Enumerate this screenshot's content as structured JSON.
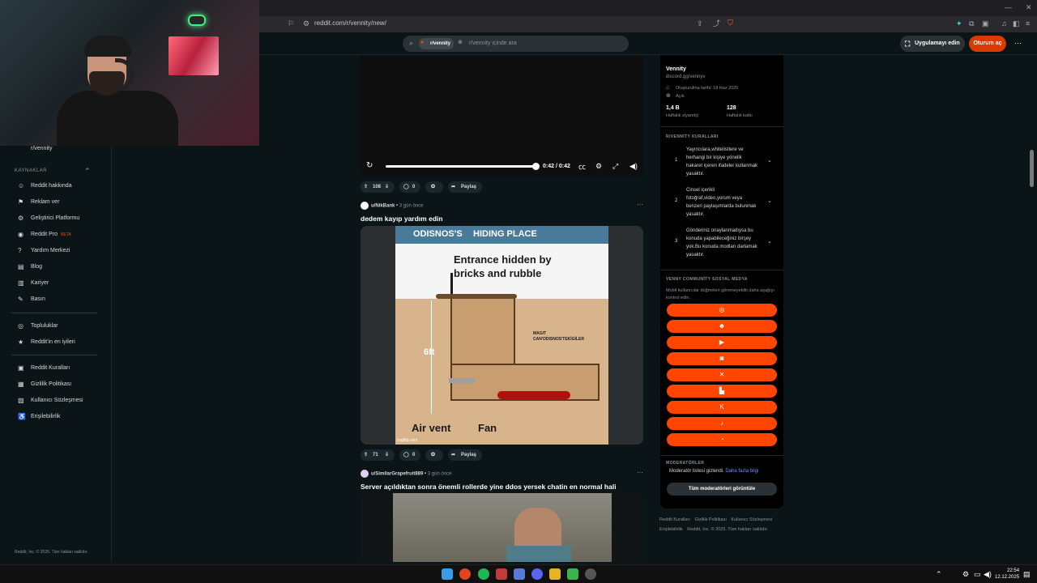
{
  "browser": {
    "url": "reddit.com/r/vennity/new/"
  },
  "header": {
    "search_chip": "r/vennity",
    "search_placeholder": "r/vennity içinde ara",
    "app_button": "Uygulamayı edin",
    "login_button": "Oturum aç"
  },
  "leftnav": {
    "partial_item": "r/vennity",
    "section_title": "KAYNAKLAR",
    "items": [
      {
        "label": "Reddit hakkında",
        "icon": "reddit-icon"
      },
      {
        "label": "Reklam ver",
        "icon": "megaphone-icon"
      },
      {
        "label": "Geliştirici Platformu",
        "icon": "gear-icon"
      },
      {
        "label": "Reddit Pro",
        "icon": "reddit-pro-icon",
        "badge": "BETA"
      },
      {
        "label": "Yardım Merkezi",
        "icon": "help-icon"
      },
      {
        "label": "Blog",
        "icon": "book-icon"
      },
      {
        "label": "Kariyer",
        "icon": "briefcase-icon"
      },
      {
        "label": "Basın",
        "icon": "mic-icon"
      },
      {
        "label": "Topluluklar",
        "icon": "communities-icon"
      },
      {
        "label": "Reddit'in en iyileri",
        "icon": "best-of-icon"
      },
      {
        "label": "Reddit Kuralları",
        "icon": "rules-icon"
      },
      {
        "label": "Gizlilik Politikası",
        "icon": "privacy-icon"
      },
      {
        "label": "Kullanıcı Sözleşmesi",
        "icon": "agreement-icon"
      },
      {
        "label": "Erişilebilirlik",
        "icon": "accessibility-icon"
      }
    ],
    "footer": "Reddit, Inc. © 2025. Tüm hakları saklıdır."
  },
  "video1": {
    "time": "0:42 / 0:42",
    "progress": 1.0,
    "upvotes": "108",
    "comments": "0",
    "share": "Paylaş"
  },
  "post2": {
    "author": "u/NikBank",
    "time": "3 gün önce",
    "title": "dedem kayıp yardım edin",
    "upvotes": "71",
    "comments": "0",
    "share": "Paylaş",
    "meme": {
      "header_left": "ODISNOS'S",
      "header_right": "HIDING PLACE",
      "line1": "Entrance hidden by",
      "line2": "bricks and rubble",
      "depth": "6ft",
      "air_vent": "Air vent",
      "fan": "Fan",
      "small_label1": "MAGIT",
      "small_label2": "CAN'ODISNOS'TEKİGİLER",
      "watermark": "imgflip.com"
    }
  },
  "post3": {
    "author": "u/SimilarGrapefruit889",
    "time": "3 gün önce",
    "title": "Server açıldıktan sonra önemli rollerde yine ddos yersek chatin en normal hali"
  },
  "sidebar": {
    "community_name": "Vennity",
    "link": "discord.gg/vennyv",
    "created": "Oluşturulma tarihi: 18 Haz 2025",
    "status": "Açık",
    "visitors_value": "1,4 B",
    "visitors_label": "Haftalık ziyaretçi",
    "contrib_value": "128",
    "contrib_label": "Haftalık katkı",
    "rules_title": "R/VENNİTY KURALLARI",
    "rules": [
      {
        "num": "1",
        "text": "Yayıncılara,whitelistlere ve herhangi bir kişiye yönelik hakaret içeren ifadeler kullanmak yasaktır."
      },
      {
        "num": "2",
        "text": "Cinsel içerikli fotoğraf,video,yorum veya benzeri paylaşımlarda bulunmak yasaktır."
      },
      {
        "num": "3",
        "text": "Gönderiniz onaylanmadıysa bu konuda yapabileceğiniz birşey yok.Bu konuda modları darlamak yasaktır."
      }
    ],
    "social_title": "VENNY COMMUNİTY SOSYAL MEDYA",
    "social_desc": "Mobil kullanıcılar düğmeleri göremeyebilir,daha aşağıyı kontrol edin.",
    "social_buttons": [
      "globe-icon",
      "discord-icon",
      "youtube-icon",
      "instagram-icon",
      "x-icon",
      "twitch-icon",
      "kick-icon",
      "tiktok-icon",
      "steam-icon"
    ],
    "mods_title": "MODERATÖRLER",
    "mods_hidden": "Moderatör listesi gizlendi.",
    "mods_more": "Daha fazla bilgi",
    "mods_button": "Tüm moderatörleri görüntüle"
  },
  "footer_links": {
    "rules": "Reddit Kuralları",
    "privacy": "Gizlilik Politikası",
    "agreement": "Kullanıcı Sözleşmesi",
    "accessibility": "Erişilebilirlik",
    "copyright": "Reddit, Inc. © 2025. Tüm hakları saklıdır."
  },
  "taskbar": {
    "time": "22:54",
    "date": "12.12.2025"
  },
  "colors": {
    "accent": "#ff4500",
    "login": "#d93a00",
    "background": "#0b1416"
  }
}
